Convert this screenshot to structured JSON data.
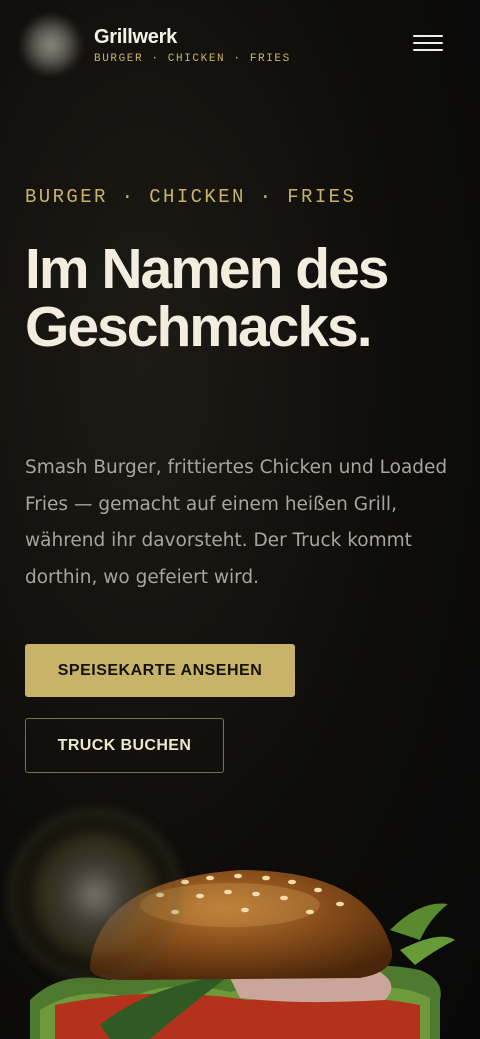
{
  "header": {
    "brand_name": "Grillwerk",
    "brand_tagline": "BURGER · CHICKEN · FRIES",
    "menu_icon": "hamburger-menu-icon"
  },
  "hero": {
    "eyebrow": "BURGER · CHICKEN · FRIES",
    "title": "Im Namen des Geschmacks.",
    "text": "Smash Burger, frittiertes Chicken und Loaded Fries — gemacht auf einem heißen Grill, während ihr davorsteht. Der Truck kommt dorthin, wo gefeiert wird.",
    "primary_cta": "SPEISEKARTE ANSEHEN",
    "secondary_cta": "TRUCK BUCHEN"
  },
  "colors": {
    "accent_gold": "#c9b26a",
    "background": "#0e0d0b",
    "heading": "#f3ede0",
    "body_text": "#a8a59d"
  }
}
